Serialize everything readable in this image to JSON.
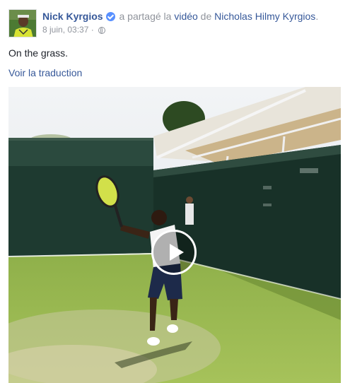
{
  "post": {
    "author": "Nick Kyrgios",
    "verified_icon": "verified-badge-icon",
    "action_prefix": "a partagé la ",
    "action_object": "vidéo",
    "action_middle": " de ",
    "shared_from": "Nicholas Hilmy Kyrgios",
    "action_suffix": ".",
    "timestamp": "8 juin, 03:37",
    "separator": " · ",
    "privacy_icon": "globe-icon",
    "message": "On the grass.",
    "translate_label": "Voir la traduction"
  },
  "video": {
    "play_icon": "play-icon"
  },
  "colors": {
    "link": "#365899",
    "meta": "#90949c",
    "text": "#1d2129",
    "verified": "#5890ff"
  }
}
